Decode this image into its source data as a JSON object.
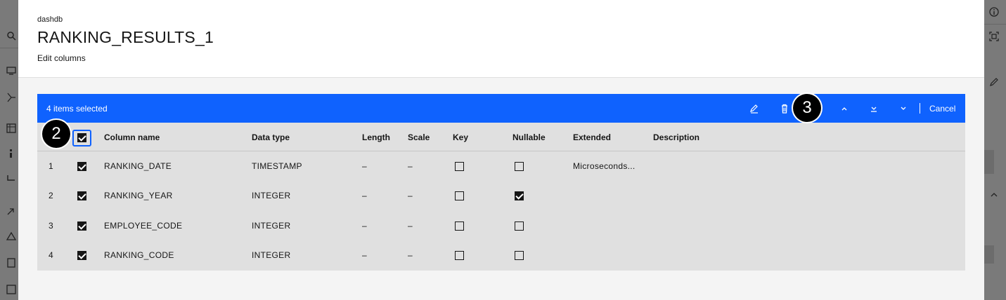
{
  "modal": {
    "eyebrow": "dashdb",
    "title": "RANKING_RESULTS_1",
    "subtitle": "Edit columns"
  },
  "batch_bar": {
    "count_text": "4 items selected",
    "cancel_label": "Cancel",
    "actions": [
      "edit-icon",
      "trash-icon",
      "move-up-icon",
      "move-to-bottom-icon",
      "move-down-icon"
    ],
    "color": "#0f62fe"
  },
  "table": {
    "columns": [
      "Column name",
      "Data type",
      "Length",
      "Scale",
      "Key",
      "Nullable",
      "Extended",
      "Description"
    ],
    "rows": [
      {
        "num": "1",
        "selected": true,
        "name": "RANKING_DATE",
        "type": "TIMESTAMP",
        "length": "–",
        "scale": "–",
        "key": false,
        "nullable": false,
        "extended": "Microseconds..."
      },
      {
        "num": "2",
        "selected": true,
        "name": "RANKING_YEAR",
        "type": "INTEGER",
        "length": "–",
        "scale": "–",
        "key": false,
        "nullable": true,
        "extended": ""
      },
      {
        "num": "3",
        "selected": true,
        "name": "EMPLOYEE_CODE",
        "type": "INTEGER",
        "length": "–",
        "scale": "–",
        "key": false,
        "nullable": false,
        "extended": ""
      },
      {
        "num": "4",
        "selected": true,
        "name": "RANKING_CODE",
        "type": "INTEGER",
        "length": "–",
        "scale": "–",
        "key": false,
        "nullable": false,
        "extended": ""
      }
    ]
  },
  "badges": [
    "2",
    "3"
  ]
}
